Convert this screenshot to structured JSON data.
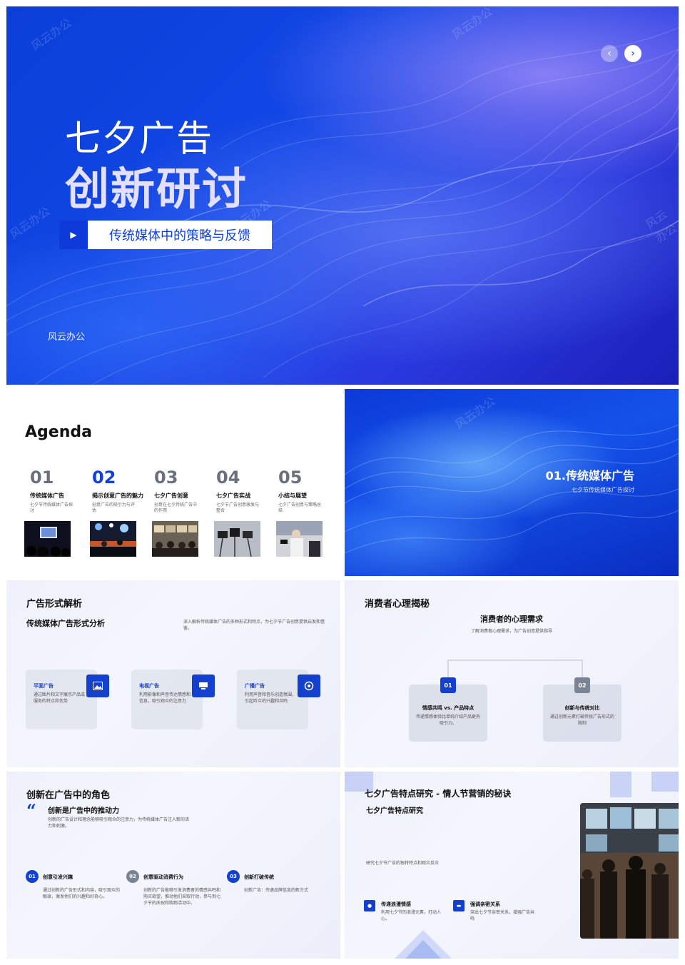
{
  "hero": {
    "title_line1": "七夕广告",
    "title_line2": "创新研讨",
    "subtitle": "传统媒体中的策略与反馈",
    "brand": "风云办公",
    "watermark": "风云办公"
  },
  "agenda": {
    "heading": "Agenda",
    "items": [
      {
        "num": "01",
        "title": "传统媒体广告",
        "desc": "七夕节传统媒体广告探讨"
      },
      {
        "num": "02",
        "title": "揭示创意广告的魅力",
        "desc": "创意广告的吸引力与评估"
      },
      {
        "num": "03",
        "title": "七夕广告创意",
        "desc": "创意在七夕传统广告中的作用"
      },
      {
        "num": "04",
        "title": "七夕广告实战",
        "desc": "七夕节广告创意激发与整合"
      },
      {
        "num": "05",
        "title": "小结与展望",
        "desc": "七夕广告创意与策略总结"
      }
    ]
  },
  "section": {
    "title": "01.传统媒体广告",
    "subtitle": "七夕节传统媒体广告探讨"
  },
  "adforms": {
    "title": "广告形式解析",
    "subheading": "传统媒体广告形式分析",
    "desc": "深入解析传统媒体广告的多种形式和特点，为七夕节广告创意提供启发和借鉴。",
    "cards": [
      {
        "title": "平面广告",
        "desc": "通过图片和文字展示产品或服务的特点和优势",
        "icon": "image-icon"
      },
      {
        "title": "电视广告",
        "desc": "利用影像和声音传达情感和信息，吸引观众的注意力",
        "icon": "tv-icon"
      },
      {
        "title": "广播广告",
        "desc": "利用声音和音乐创造氛围，引起听众的兴趣和共鸣",
        "icon": "radio-icon"
      }
    ]
  },
  "consumer": {
    "title": "消费者心理揭秘",
    "center_title": "消费者的心理需求",
    "center_sub": "了解消费者心理需求，为广告创意提供指导",
    "boxes": [
      {
        "num": "01",
        "title": "情感共鸣 vs. 产品特点",
        "desc": "传递情感体验比单纯介绍产品更有吸引力。"
      },
      {
        "num": "02",
        "title": "创新与传统对比",
        "desc": "通过创新元素打破传统广告形式的限制"
      }
    ]
  },
  "innovation": {
    "title": "创新在广告中的角色",
    "quote_mark": "“",
    "quote_title": "创新是广告中的推动力",
    "quote_desc": "创新的广告设计和理念能够吸引观众的注意力，为传统媒体广告注入新的活力和刺激。",
    "items": [
      {
        "num": "01",
        "title": "创意引发兴趣",
        "desc": "通过创新的广告形式和内容，吸引观众的眼球，激发他们的兴趣和好奇心。"
      },
      {
        "num": "02",
        "title": "创意驱动消费行为",
        "desc": "创新的广告能够引发消费者的情感共鸣和购买欲望，推动他们采取行动，参与到七夕节的庆祝和购物活动中。"
      },
      {
        "num": "03",
        "title": "创新打破传统",
        "desc": "创新广告：传递品牌信息的新方式"
      }
    ]
  },
  "features": {
    "title": "七夕广告特点研究 - 情人节营销的秘诀",
    "subheading": "七夕广告特点研究",
    "desc": "研究七夕节广告的独特特点和观众反应",
    "items": [
      {
        "title": "传递浪漫情感",
        "desc": "利用七夕节的浪漫元素，打动人心。",
        "icon": "heart-icon"
      },
      {
        "title": "强调亲密关系",
        "desc": "突出七夕节亲密关系，增强广告共鸣",
        "icon": "message-icon"
      }
    ]
  },
  "colors": {
    "accent": "#1440d0",
    "badge_gray": "#7a8494"
  }
}
